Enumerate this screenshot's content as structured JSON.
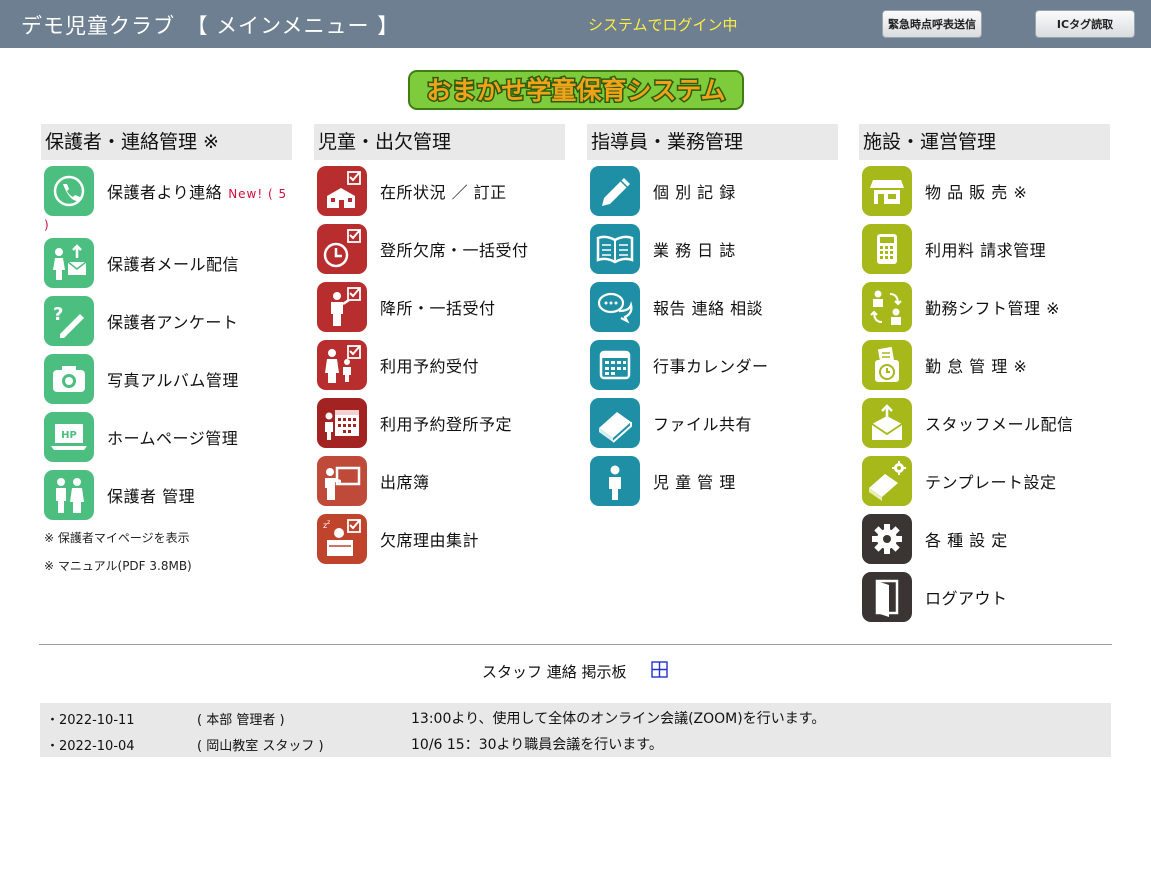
{
  "header": {
    "title": "デモ児童クラブ　【 メインメニュー 】",
    "status": "システムでログイン中",
    "emergency_button": "緊急時点呼表送信",
    "ic_button": "ICタグ読取"
  },
  "logo_text": "おまかせ学童保育システム",
  "columns": [
    {
      "title": "保護者・連絡管理 ※",
      "items": [
        {
          "label": "保護者より連絡",
          "badge": "New! ( 5",
          "badge_cont": ")"
        },
        {
          "label": "保護者メール配信"
        },
        {
          "label": "保護者アンケート"
        },
        {
          "label": "写真アルバム管理"
        },
        {
          "label": "ホームページ管理"
        },
        {
          "label": "保護者 管理"
        }
      ],
      "notes": [
        "※ 保護者マイページを表示",
        "※ マニュアル(PDF 3.8MB)"
      ]
    },
    {
      "title": "児童・出欠管理",
      "items": [
        {
          "label": "在所状況 ／ 訂正"
        },
        {
          "label": "登所欠席・一括受付"
        },
        {
          "label": "降所・一括受付"
        },
        {
          "label": "利用予約受付"
        },
        {
          "label": "利用予約登所予定"
        },
        {
          "label": "出席簿"
        },
        {
          "label": "欠席理由集計"
        }
      ]
    },
    {
      "title": "指導員・業務管理",
      "items": [
        {
          "label": "個 別 記 録"
        },
        {
          "label": "業 務 日 誌"
        },
        {
          "label": "報告 連絡 相談"
        },
        {
          "label": "行事カレンダー"
        },
        {
          "label": "ファイル共有"
        },
        {
          "label": "児 童 管 理"
        }
      ]
    },
    {
      "title": "施設・運営管理",
      "items": [
        {
          "label": "物 品 販 売 ※"
        },
        {
          "label": "利用料 請求管理"
        },
        {
          "label": "勤務シフト管理 ※"
        },
        {
          "label": "勤 怠 管 理 ※"
        },
        {
          "label": "スタッフメール配信"
        },
        {
          "label": "テンプレート設定"
        },
        {
          "label": "各 種 設 定"
        },
        {
          "label": "ログアウト"
        }
      ]
    }
  ],
  "board": {
    "title": "スタッフ 連絡 掲示板",
    "messages": [
      {
        "date": "・2022-10-11",
        "author": "( 本部 管理者 )",
        "text": "13:00より、使用して全体のオンライン会議(ZOOM)を行います。"
      },
      {
        "date": "・2022-10-04",
        "author": "( 岡山教室 スタッフ )",
        "text": "10/6 15：30より職員会議を行います。"
      }
    ]
  },
  "colors": {
    "header_bg": "#6e7f92",
    "status_yellow": "#ffee44",
    "green": "#4cbf80",
    "red": "#b82e2e",
    "teal": "#1f8fa5",
    "olive": "#a7b81a",
    "dark": "#3a3433",
    "logo_green": "#4f9e22",
    "logo_orange": "#f2a21a"
  }
}
